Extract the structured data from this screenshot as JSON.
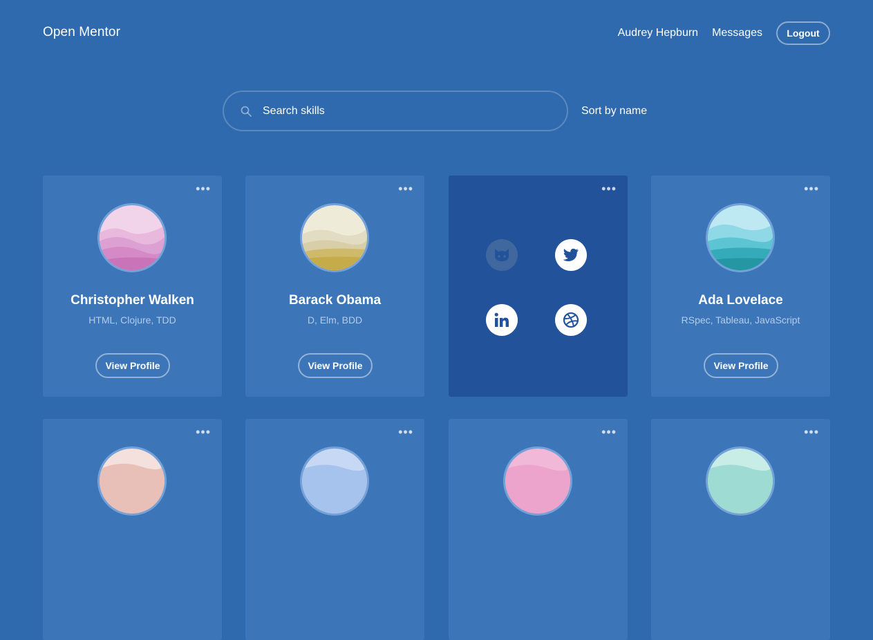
{
  "header": {
    "brand": "Open Mentor",
    "nav": [
      "Audrey Hepburn",
      "Messages"
    ],
    "logout_label": "Logout"
  },
  "search": {
    "placeholder": "Search skills",
    "sort_label": "Sort by name"
  },
  "colors": {
    "background": "#2f69ae",
    "card": "#3d76b8",
    "card_flipped": "#22539a"
  },
  "cards_row1": [
    {
      "name": "Christopher Walken",
      "skills": "HTML, Clojure, TDD",
      "button": "View Profile",
      "avatar": "pink-mountains"
    },
    {
      "name": "Barack Obama",
      "skills": "D, Elm, BDD",
      "button": "View Profile",
      "avatar": "golden-dunes"
    },
    {
      "flipped": true,
      "icons": [
        "github-icon",
        "twitter-icon",
        "linkedin-icon",
        "dribbble-icon"
      ]
    },
    {
      "name": "Ada Lovelace",
      "skills": "RSpec, Tableau, JavaScript",
      "button": "View Profile",
      "avatar": "teal-hills"
    }
  ],
  "menu_glyph": "•••"
}
